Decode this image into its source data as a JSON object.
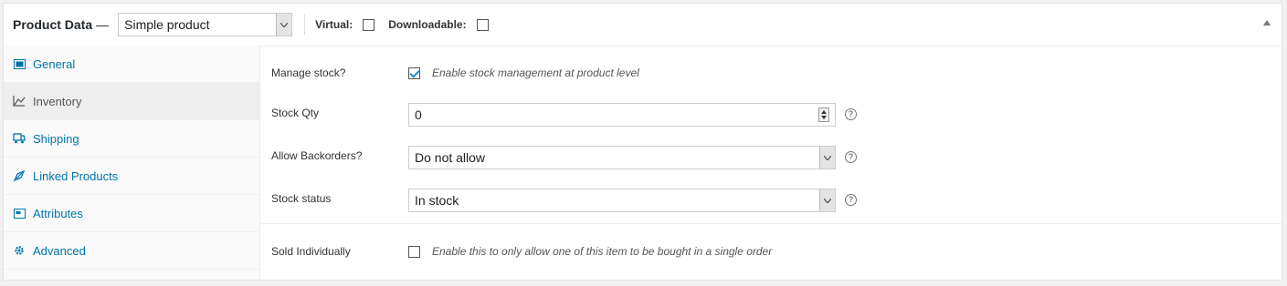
{
  "header": {
    "title": "Product Data",
    "dash": "—",
    "product_type": "Simple product",
    "virtual_label": "Virtual:",
    "downloadable_label": "Downloadable:",
    "virtual_checked": false,
    "downloadable_checked": false
  },
  "tabs": [
    {
      "label": "General",
      "icon": "general-icon",
      "active": false
    },
    {
      "label": "Inventory",
      "icon": "inventory-icon",
      "active": true
    },
    {
      "label": "Shipping",
      "icon": "shipping-icon",
      "active": false
    },
    {
      "label": "Linked Products",
      "icon": "link-icon",
      "active": false
    },
    {
      "label": "Attributes",
      "icon": "attributes-icon",
      "active": false
    },
    {
      "label": "Advanced",
      "icon": "gear-icon",
      "active": false
    }
  ],
  "inventory": {
    "manage_stock_label": "Manage stock?",
    "manage_stock_desc": "Enable stock management at product level",
    "manage_stock_checked": true,
    "stock_qty_label": "Stock Qty",
    "stock_qty_value": "0",
    "backorders_label": "Allow Backorders?",
    "backorders_value": "Do not allow",
    "stock_status_label": "Stock status",
    "stock_status_value": "In stock",
    "sold_individually_label": "Sold Individually",
    "sold_individually_desc": "Enable this to only allow one of this item to be bought in a single order",
    "sold_individually_checked": false,
    "help_glyph": "?"
  },
  "colors": {
    "link": "#0073aa",
    "check": "#1e8cbe",
    "active_tab_bg": "#eeeeee"
  }
}
